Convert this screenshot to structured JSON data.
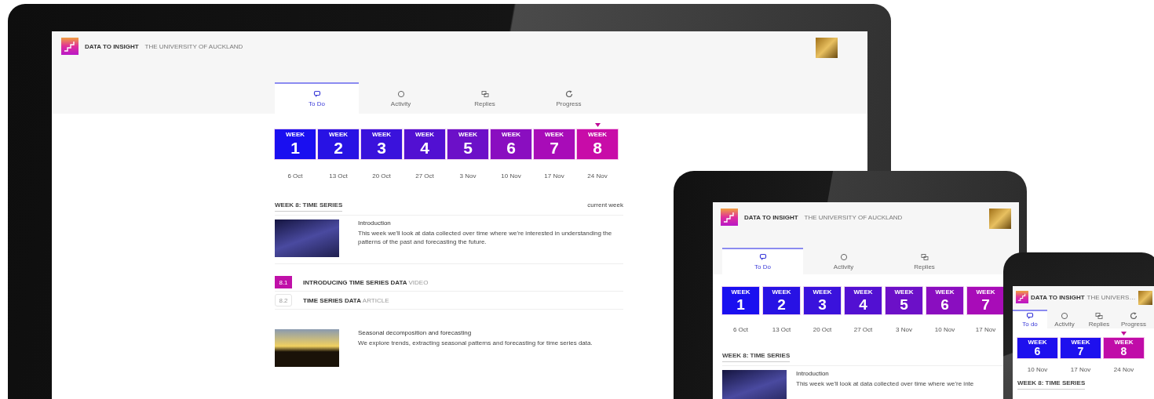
{
  "devices": [
    {
      "kind": "desktop",
      "screen": {
        "brand": "DATA TO INSIGHT",
        "institution": "THE UNIVERSITY OF AUCKLAND",
        "tabs": [
          {
            "label": "To Do",
            "selected": true
          },
          {
            "label": "Activity",
            "selected": false
          },
          {
            "label": "Replies",
            "selected": false
          },
          {
            "label": "Progress",
            "selected": false
          }
        ],
        "weeks": [
          {
            "label": "WEEK",
            "number": "1",
            "date": "6 Oct",
            "color": "#1a0ff0",
            "selected": false
          },
          {
            "label": "WEEK",
            "number": "2",
            "date": "13 Oct",
            "color": "#2812e4",
            "selected": false
          },
          {
            "label": "WEEK",
            "number": "3",
            "date": "20 Oct",
            "color": "#3a12dc",
            "selected": false
          },
          {
            "label": "WEEK",
            "number": "4",
            "date": "27 Oct",
            "color": "#5210d2",
            "selected": false
          },
          {
            "label": "WEEK",
            "number": "5",
            "date": "3 Nov",
            "color": "#6c10c8",
            "selected": false
          },
          {
            "label": "WEEK",
            "number": "6",
            "date": "10 Nov",
            "color": "#8a0ec0",
            "selected": false
          },
          {
            "label": "WEEK",
            "number": "7",
            "date": "17 Nov",
            "color": "#a80cb8",
            "selected": false
          },
          {
            "label": "WEEK",
            "number": "8",
            "date": "24 Nov",
            "color": "#c80ca8",
            "selected": true
          }
        ],
        "section": {
          "title": "WEEK 8: TIME SERIES",
          "note": "current week"
        },
        "items": [
          {
            "kind": "lesson",
            "title": "Introduction",
            "text": "This week we'll look at data collected over time where we're interested in understanding the patterns of the past and forecasting the future."
          },
          {
            "kind": "step",
            "number": "8.1",
            "title": "INTRODUCING TIME SERIES DATA",
            "type": "VIDEO",
            "completed": true
          },
          {
            "kind": "step",
            "number": "8.2",
            "title": "TIME SERIES DATA",
            "type": "ARTICLE",
            "completed": false
          },
          {
            "kind": "lesson",
            "title": "Seasonal decomposition and forecasting",
            "text": "We explore trends, extracting seasonal patterns and forecasting for time series data."
          }
        ]
      }
    },
    {
      "kind": "tablet",
      "screen": {
        "brand": "DATA TO INSIGHT",
        "institution": "THE UNIVERSITY OF AUCKLAND",
        "tabs": [
          {
            "label": "To Do",
            "selected": true
          },
          {
            "label": "Activity",
            "selected": false
          },
          {
            "label": "Replies",
            "selected": false
          }
        ],
        "weeks": [
          {
            "label": "WEEK",
            "number": "1",
            "date": "6 Oct",
            "color": "#1a0ff0",
            "selected": false
          },
          {
            "label": "WEEK",
            "number": "2",
            "date": "13 Oct",
            "color": "#2812e4",
            "selected": false
          },
          {
            "label": "WEEK",
            "number": "3",
            "date": "20 Oct",
            "color": "#3a12dc",
            "selected": false
          },
          {
            "label": "WEEK",
            "number": "4",
            "date": "27 Oct",
            "color": "#5210d2",
            "selected": false
          },
          {
            "label": "WEEK",
            "number": "5",
            "date": "3 Nov",
            "color": "#6c10c8",
            "selected": false
          },
          {
            "label": "WEEK",
            "number": "6",
            "date": "10 Nov",
            "color": "#8a0ec0",
            "selected": false
          },
          {
            "label": "WEEK",
            "number": "7",
            "date": "17 Nov",
            "color": "#a80cb8",
            "selected": false
          }
        ],
        "section": {
          "title": "WEEK 8: TIME SERIES"
        },
        "items": [
          {
            "kind": "lesson",
            "title": "Introduction",
            "text": "This week we'll look at data collected over time where we're inte"
          }
        ]
      }
    },
    {
      "kind": "phone",
      "screen": {
        "brand": "DATA TO INSIGHT",
        "institution": "THE UNIVERS…",
        "tabs": [
          {
            "label": "To do",
            "selected": true
          },
          {
            "label": "Activity",
            "selected": false
          },
          {
            "label": "Replies",
            "selected": false
          },
          {
            "label": "Progress",
            "selected": false
          }
        ],
        "weeks": [
          {
            "label": "WEEK",
            "number": "6",
            "date": "10 Nov",
            "color": "#1e10ee",
            "selected": false
          },
          {
            "label": "WEEK",
            "number": "7",
            "date": "17 Nov",
            "color": "#1e10ee",
            "selected": false
          },
          {
            "label": "WEEK",
            "number": "8",
            "date": "24 Nov",
            "color": "#c00ca8",
            "selected": true
          }
        ],
        "section": {
          "title": "WEEK 8: TIME SERIES"
        }
      }
    }
  ]
}
